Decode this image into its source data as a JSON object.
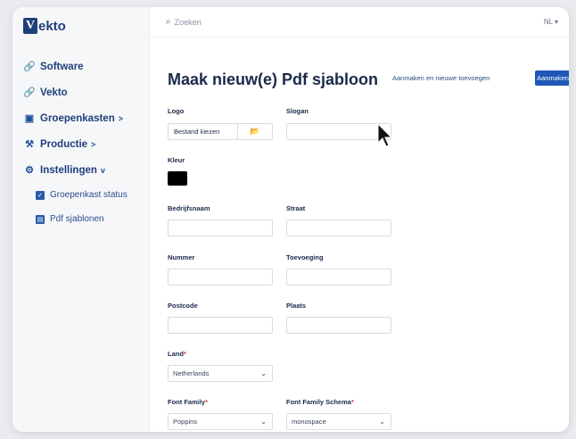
{
  "app": {
    "logo_letter": "V",
    "logo_text": "ekto"
  },
  "sidebar": {
    "items": [
      {
        "label": "Software",
        "icon": "link-icon"
      },
      {
        "label": "Vekto",
        "icon": "link-icon"
      },
      {
        "label": "Groepenkasten",
        "icon": "box-icon",
        "chevron": ">"
      },
      {
        "label": "Productie",
        "icon": "tools-icon",
        "chevron": ">"
      },
      {
        "label": "Instellingen",
        "icon": "gear-icon",
        "chevron": "v"
      }
    ],
    "subitems": [
      {
        "label": "Groepenkast status",
        "icon": "checkbox-icon"
      },
      {
        "label": "Pdf sjablonen",
        "icon": "file-icon"
      }
    ]
  },
  "topbar": {
    "search_placeholder": "Zoeken",
    "lang": "NL ▾"
  },
  "page": {
    "title": "Maak nieuw(e) Pdf sjabloon",
    "create_add_label": "Aanmaken en nieuwe toevoegen",
    "create_label": "Aanmaken"
  },
  "form": {
    "logo_label": "Logo",
    "file_button": "Bestand kiezen",
    "slogan_label": "Slogan",
    "color_label": "Kleur",
    "color_value": "#000000",
    "company_label": "Bedrijfsnaam",
    "street_label": "Straat",
    "number_label": "Nummer",
    "addition_label": "Toevoeging",
    "postcode_label": "Postcode",
    "city_label": "Plaats",
    "country_label": "Land",
    "country_value": "Netherlands",
    "font_family_label": "Font Family",
    "font_family_value": "Poppins",
    "font_schema_label": "Font Family Schema",
    "font_schema_value": "monospace",
    "required_mark": "*"
  }
}
